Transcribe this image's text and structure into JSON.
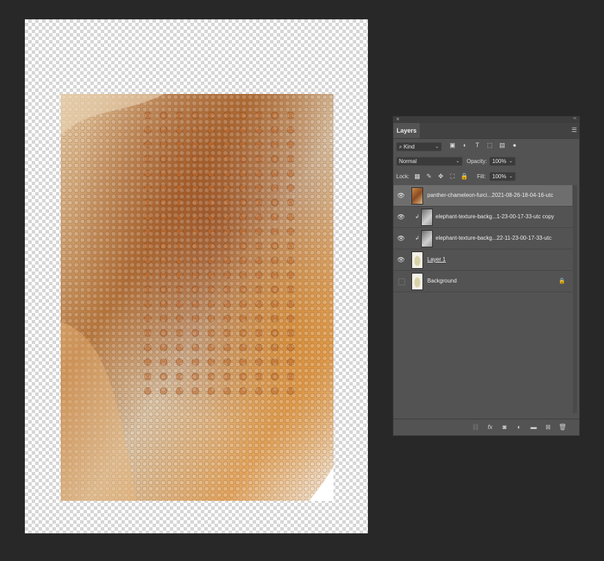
{
  "panel": {
    "close_glyph": "×",
    "collapse_glyph": "‹‹",
    "tab_label": "Layers",
    "menu_icon": "menu-icon",
    "filter": {
      "kind_label": "Kind",
      "search_glyph": "⌕"
    },
    "blend_mode": "Normal",
    "opacity_label": "Opacity:",
    "opacity_value": "100%",
    "lock_label": "Lock:",
    "fill_label": "Fill:",
    "fill_value": "100%"
  },
  "layers": [
    {
      "name": "panther-chameleon-furci...2021-08-26-18-04-16-utc",
      "visible": true,
      "selected": true,
      "thumb": "chameleon",
      "clipped": false,
      "locked": false,
      "underlined": false
    },
    {
      "name": "elephant-texture-backg...1-23-00-17-33-utc copy",
      "visible": true,
      "selected": false,
      "thumb": "elephant",
      "clipped": true,
      "locked": false,
      "underlined": false
    },
    {
      "name": "elephant-texture-backg...22-11-23-00-17-33-utc",
      "visible": true,
      "selected": false,
      "thumb": "elephant",
      "clipped": true,
      "locked": false,
      "underlined": false
    },
    {
      "name": "Layer 1",
      "visible": true,
      "selected": false,
      "thumb": "egg",
      "clipped": false,
      "locked": false,
      "underlined": true
    },
    {
      "name": "Background",
      "visible": false,
      "selected": false,
      "thumb": "egg",
      "clipped": false,
      "locked": true,
      "underlined": false
    }
  ],
  "glyphs": {
    "eye": "👁",
    "clip": "↲",
    "chev": "⌄",
    "lock": "🔒",
    "link": "8"
  },
  "footer_icons": [
    "link-layers-icon",
    "fx-icon",
    "add-mask-icon",
    "adjustment-layer-icon",
    "new-group-icon",
    "new-layer-icon",
    "delete-layer-icon"
  ],
  "colors": {
    "app_bg": "#282828",
    "panel_bg": "#535353",
    "selected_row": "#6e6e6e"
  }
}
